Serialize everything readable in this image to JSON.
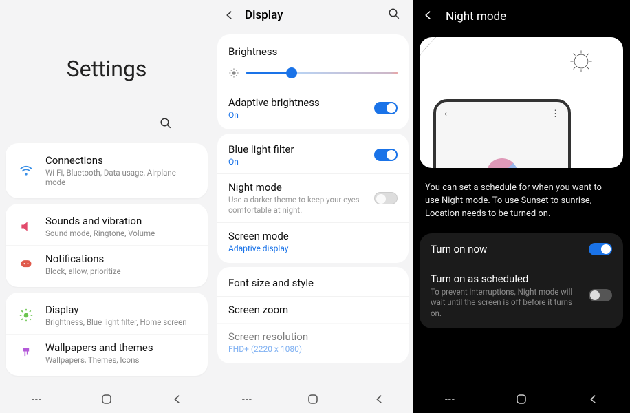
{
  "screen1": {
    "title": "Settings",
    "groups": [
      {
        "rows": [
          {
            "icon": "wifi-icon",
            "color": "#3a8fe6",
            "title": "Connections",
            "sub": "Wi-Fi, Bluetooth, Data usage, Airplane mode"
          }
        ]
      },
      {
        "rows": [
          {
            "icon": "speaker-icon",
            "color": "#e24a6b",
            "title": "Sounds and vibration",
            "sub": "Sound mode, Ringtone, Volume"
          },
          {
            "icon": "message-icon",
            "color": "#e05a4c",
            "title": "Notifications",
            "sub": "Block, allow, prioritize"
          }
        ]
      },
      {
        "rows": [
          {
            "icon": "brightness-icon",
            "color": "#6cc551",
            "title": "Display",
            "sub": "Brightness, Blue light filter, Home screen"
          },
          {
            "icon": "brush-icon",
            "color": "#b45ad9",
            "title": "Wallpapers and themes",
            "sub": "Wallpapers, Themes, Icons"
          }
        ]
      }
    ]
  },
  "screen2": {
    "title": "Display",
    "brightness": {
      "label": "Brightness",
      "value": 30
    },
    "group1": [
      {
        "label": "Adaptive brightness",
        "value": "On",
        "toggle": "on"
      },
      {
        "label": "Blue light filter",
        "value": "On",
        "toggle": "on"
      },
      {
        "label": "Night mode",
        "desc": "Use a darker theme to keep your eyes comfortable at night.",
        "toggle": "off"
      },
      {
        "label": "Screen mode",
        "value": "Adaptive display"
      }
    ],
    "group2": [
      {
        "label": "Font size and style"
      },
      {
        "label": "Screen zoom"
      },
      {
        "label": "Screen resolution",
        "value": "FHD+ (2220 x 1080)"
      }
    ]
  },
  "screen3": {
    "title": "Night mode",
    "info": "You can set a schedule for when you want to use Night mode. To use Sunset to sunrise, Location needs to be turned on.",
    "items": [
      {
        "label": "Turn on now",
        "toggle": "on"
      },
      {
        "label": "Turn on as scheduled",
        "desc": "To prevent interruptions, Night mode will wait until the screen is off before it turns on.",
        "toggle": "off"
      }
    ]
  }
}
